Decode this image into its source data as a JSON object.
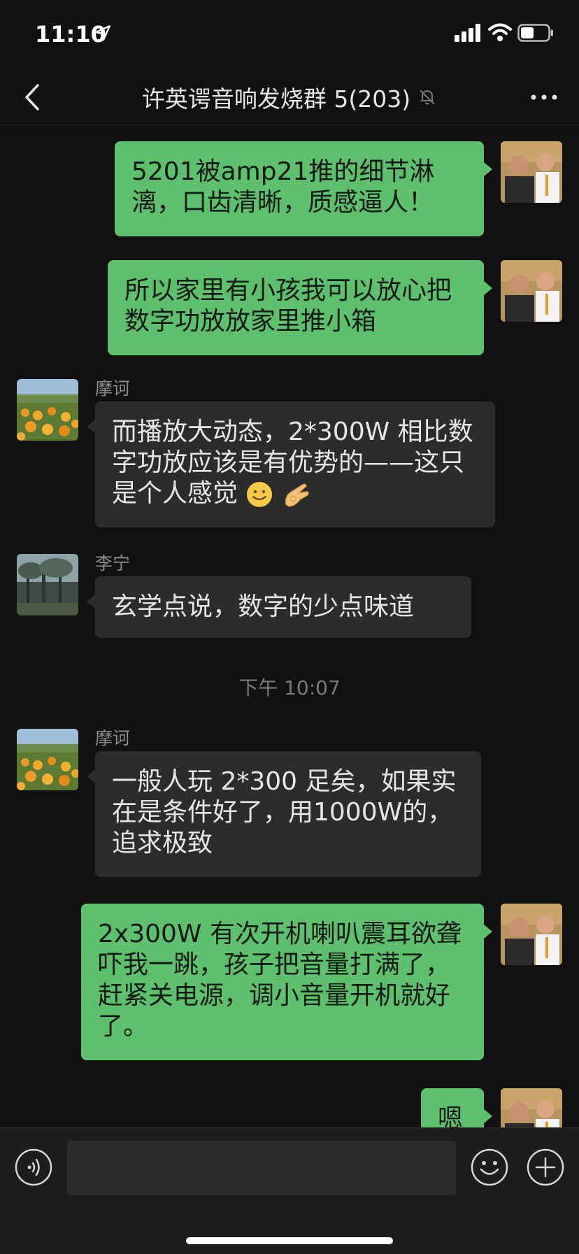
{
  "status": {
    "time": "11:10"
  },
  "header": {
    "title": "许英谔音响发烧群 5(203)"
  },
  "messages": [
    {
      "text": "5201被amp21推的细节淋漓，口齿清晰，质感逼人！"
    },
    {
      "text": "所以家里有小孩我可以放心把数字功放放家里推小箱"
    },
    {
      "sender": "摩诃",
      "text": "而播放大动态，2*300W 相比数字功放应该是有优势的——这只是个人感觉"
    },
    {
      "sender": "李宁",
      "text": "玄学点说，数字的少点味道"
    },
    {
      "timestamp": "下午 10:07"
    },
    {
      "sender": "摩诃",
      "text": "一般人玩 2*300 足矣，如果实在是条件好了，用1000W的，追求极致"
    },
    {
      "text": "2x300W 有次开机喇叭震耳欲聋吓我一跳，孩子把音量打满了，赶紧关电源，调小音量开机就好了。"
    },
    {
      "text": "嗯"
    }
  ],
  "colors": {
    "mine_bubble": "#5ec06e",
    "other_bubble": "#2c2c2c",
    "background": "#111111"
  }
}
